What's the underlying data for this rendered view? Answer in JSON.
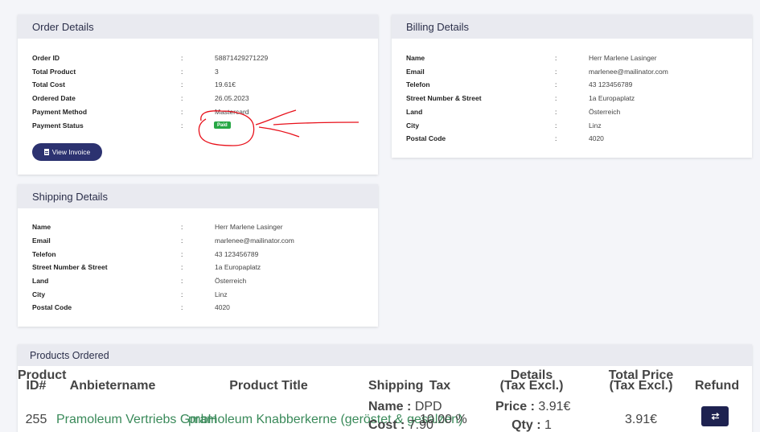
{
  "order": {
    "title": "Order Details",
    "fields": [
      {
        "label": "Order ID",
        "value": "58871429271229"
      },
      {
        "label": "Total Product",
        "value": "3"
      },
      {
        "label": "Total Cost",
        "value": "19.61€"
      },
      {
        "label": "Ordered Date",
        "value": "26.05.2023"
      },
      {
        "label": "Payment Method",
        "value": "Mastercard"
      },
      {
        "label": "Payment Status",
        "value": ""
      }
    ],
    "status_badge": "Paid",
    "invoice_button": "View Invoice"
  },
  "billing": {
    "title": "Billing Details",
    "fields": [
      {
        "label": "Name",
        "value": "Herr Marlene Lasinger"
      },
      {
        "label": "Email",
        "value": "marlenee@mailinator.com"
      },
      {
        "label": "Telefon",
        "value": "43 123456789"
      },
      {
        "label": "Street Number & Street",
        "value": "1a Europaplatz"
      },
      {
        "label": "Land",
        "value": "Österreich"
      },
      {
        "label": "City",
        "value": "Linz"
      },
      {
        "label": "Postal Code",
        "value": "4020"
      }
    ]
  },
  "shipping": {
    "title": "Shipping Details",
    "fields": [
      {
        "label": "Name",
        "value": "Herr Marlene Lasinger"
      },
      {
        "label": "Email",
        "value": "marlenee@mailinator.com"
      },
      {
        "label": "Telefon",
        "value": "43 123456789"
      },
      {
        "label": "Street Number & Street",
        "value": "1a Europaplatz"
      },
      {
        "label": "Land",
        "value": "Österreich"
      },
      {
        "label": "City",
        "value": "Linz"
      },
      {
        "label": "Postal Code",
        "value": "4020"
      }
    ]
  },
  "separator": ":",
  "products": {
    "title": "Products Ordered",
    "headers": {
      "id_line1": "Product",
      "id_line2": "ID#",
      "vendor": "Anbietername",
      "product_title": "Product Title",
      "shipping": "Shipping",
      "tax": "Tax",
      "details_line1": "Details",
      "details_line2": "(Tax Excl.)",
      "total_line1": "Total Price",
      "total_line2": "(Tax Excl.)",
      "refund": "Refund"
    },
    "rows": [
      {
        "id": "255",
        "vendor": "Pramoleum Vertriebs GmbH",
        "product_title": "pramoleum Knabberkerne (geröstet & gesalzen)",
        "shipping_name_label": "Name :",
        "shipping_name": "DPD",
        "shipping_cost_label": "Cost :",
        "shipping_cost": "7.90",
        "tax": "10.00 %",
        "price_label": "Price :",
        "price": "3.91€",
        "qty_label": "Qty :",
        "qty": "1",
        "total": "3.91€",
        "refund_icon": "swap-arrows-icon"
      }
    ]
  },
  "colors": {
    "primary": "#2c3270",
    "header_bg": "#e9eaf0",
    "paid": "#27a745",
    "link_green": "#3a8a5a",
    "annotation_red": "#e8101a"
  }
}
